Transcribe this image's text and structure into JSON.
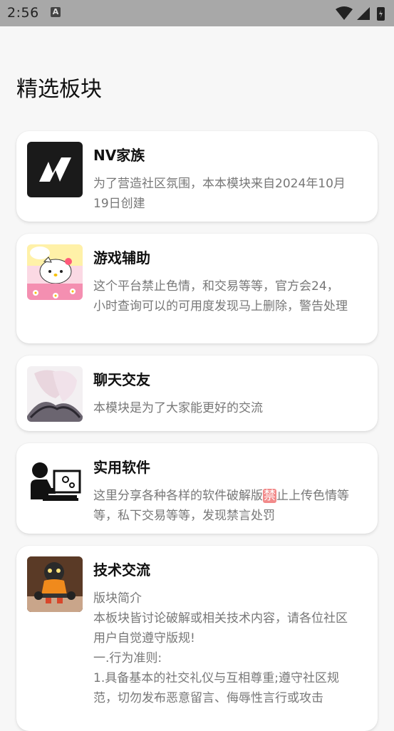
{
  "status": {
    "time": "2:56",
    "notif_icon": "a-badge-icon"
  },
  "page_title": "精选板块",
  "cards": [
    {
      "title": "NV家族",
      "desc": "为了营造社区氛围，本本模块来自2024年10月19日创建",
      "icon": "nv-logo"
    },
    {
      "title": "游戏辅助",
      "desc": "这个平台禁止色情，和交易等等，官方会24，小时查询可以的可用度发现马上删除，警告处理",
      "icon": "hello-kitty-thumb"
    },
    {
      "title": "聊天交友",
      "desc": "本模块是为了大家能更好的交流",
      "icon": "anime-thumb"
    },
    {
      "title": "实用软件",
      "desc_pre": "这里分享各种各样的软件破解版",
      "desc_badge": "禁",
      "desc_post": "止上传色情等等，私下交易等等，发现禁言处罚",
      "icon": "computer-user-thumb"
    },
    {
      "title": "技术交流",
      "desc": "版块简介\n本板块皆讨论破解或相关技术内容，请各位社区用户自觉遵守版规!\n一.行为准则:\n1.具备基本的社交礼仪与互相尊重;遵守社区规范，切勿发布恶意留言、侮辱性言行或攻击",
      "icon": "robot-figure-thumb"
    }
  ]
}
